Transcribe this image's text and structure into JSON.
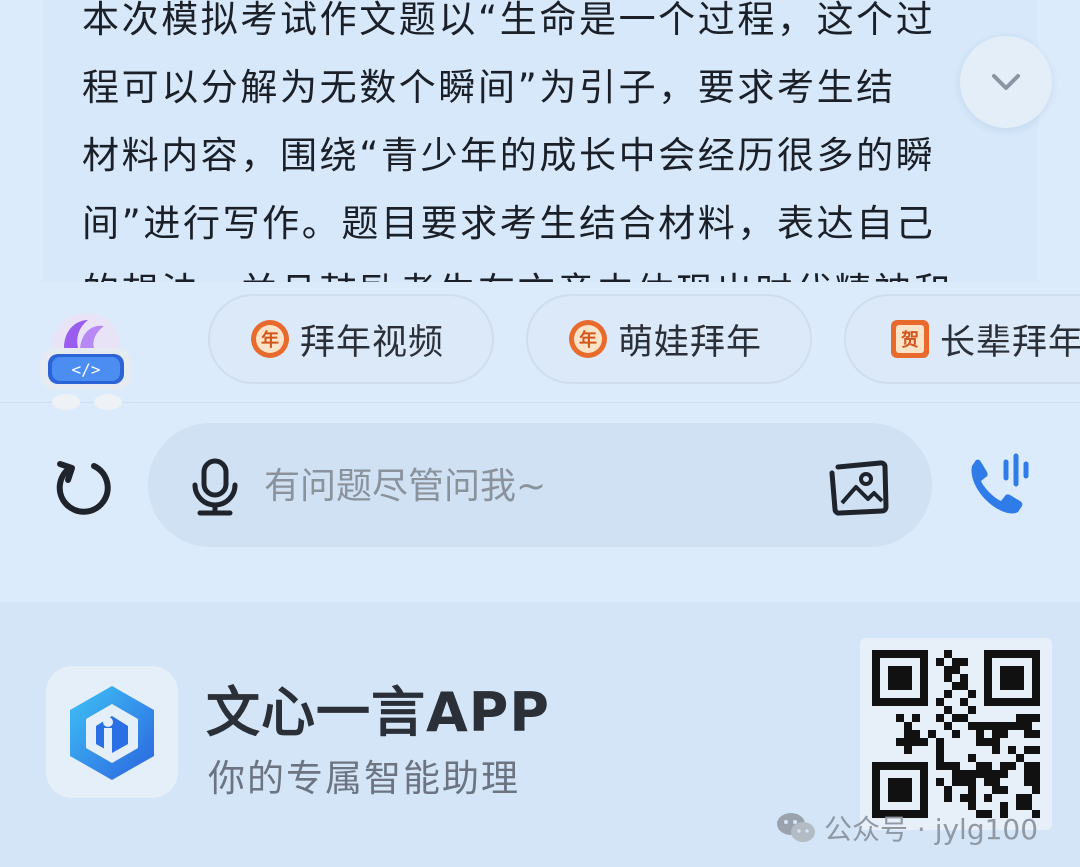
{
  "article": {
    "lines": [
      "本次模拟考试作文题以“生命是一个过程，这个过",
      "程可以分解为无数个瞬间”为引子，要求考生结",
      "材料内容，围绕“青少年的成长中会经历很多的瞬",
      "间”进行写作。题目要求考生结合材料，表达自己",
      "的想法，并且鼓励考生在文章中体现出时代精神和"
    ]
  },
  "chips": [
    {
      "label": "拜年视频",
      "icon": "nian-badge-icon"
    },
    {
      "label": "萌娃拜年",
      "icon": "nian-badge-icon"
    },
    {
      "label": "长辈拜年",
      "icon": "he-badge-icon"
    }
  ],
  "chip_badges": {
    "nian": "年",
    "he": "贺"
  },
  "input": {
    "placeholder": "有问题尽管问我~"
  },
  "promo": {
    "app_name": "文心一言APP",
    "slogan": "你的专属智能助理"
  },
  "watermark": {
    "text": "公众号 · jylg100"
  },
  "colors": {
    "accent_blue": "#2f7be8",
    "badge_orange": "#e86a2c",
    "mascot_purple": "#9b5cf0"
  }
}
